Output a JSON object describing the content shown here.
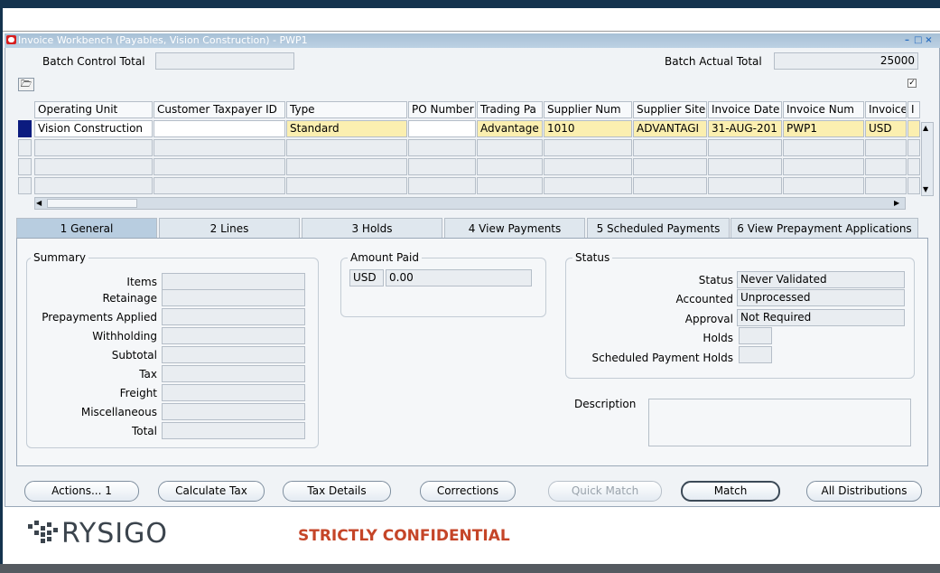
{
  "window": {
    "title": "Invoice Workbench (Payables, Vision Construction) - PWP1"
  },
  "header": {
    "batch_control_total_label": "Batch Control Total",
    "batch_control_total_value": "",
    "batch_actual_total_label": "Batch Actual Total",
    "batch_actual_total_value": "25000"
  },
  "grid": {
    "columns": [
      "Operating Unit",
      "Customer Taxpayer ID",
      "Type",
      "PO Number",
      "Trading Pa",
      "Supplier Num",
      "Supplier Site",
      "Invoice Date",
      "Invoice Num",
      "Invoice",
      "I"
    ],
    "row1": {
      "operating_unit": "Vision Construction",
      "customer_taxpayer_id": "",
      "type": "Standard",
      "po_number": "",
      "trading_partner": "Advantage",
      "supplier_num": "1010",
      "supplier_site": "ADVANTAGI",
      "invoice_date": "31-AUG-201",
      "invoice_num": "PWP1",
      "invoice_currency": "USD"
    }
  },
  "tabs": [
    {
      "label": "1 General"
    },
    {
      "label": "2 Lines"
    },
    {
      "label": "3 Holds"
    },
    {
      "label": "4 View Payments"
    },
    {
      "label": "5 Scheduled Payments"
    },
    {
      "label": "6 View Prepayment Applications"
    }
  ],
  "summary": {
    "title": "Summary",
    "items_label": "Items",
    "retainage_label": "Retainage",
    "prepayments_label": "Prepayments Applied",
    "withholding_label": "Withholding",
    "subtotal_label": "Subtotal",
    "tax_label": "Tax",
    "freight_label": "Freight",
    "misc_label": "Miscellaneous",
    "total_label": "Total"
  },
  "amount_paid": {
    "title": "Amount Paid",
    "currency": "USD",
    "value": "0.00"
  },
  "status": {
    "title": "Status",
    "status_label": "Status",
    "status_value": "Never Validated",
    "accounted_label": "Accounted",
    "accounted_value": "Unprocessed",
    "approval_label": "Approval",
    "approval_value": "Not Required",
    "holds_label": "Holds",
    "holds_value": "",
    "sched_holds_label": "Scheduled Payment Holds",
    "sched_holds_value": ""
  },
  "description": {
    "label": "Description",
    "value": ""
  },
  "buttons": {
    "actions": "Actions... 1",
    "calculate_tax": "Calculate Tax",
    "tax_details": "Tax Details",
    "corrections": "Corrections",
    "quick_match": "Quick Match",
    "match": "Match",
    "all_distributions": "All Distributions"
  },
  "footer": {
    "logo": "RYSIGO",
    "confidential": "STRICTLY CONFIDENTIAL"
  },
  "colors": {
    "required_field": "#fbefb0",
    "selected_row": "#0b1b7f",
    "confidential_text": "#c54528",
    "title_bar": "#a7c0d6"
  }
}
